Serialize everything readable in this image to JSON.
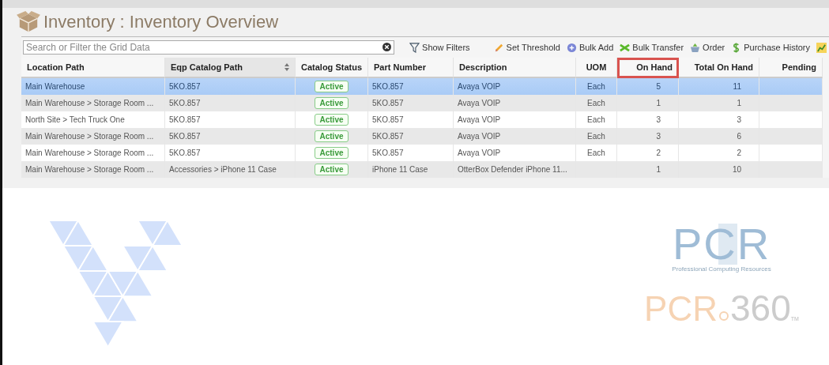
{
  "title": "Inventory : Inventory Overview",
  "search": {
    "placeholder": "Search or Filter the Grid Data"
  },
  "toolbar": [
    {
      "kind": "filter",
      "label": "Show Filters"
    },
    {
      "kind": "pencil",
      "label": "Set Threshold"
    },
    {
      "kind": "plus",
      "label": "Bulk Add"
    },
    {
      "kind": "transfer",
      "label": "Bulk Transfer"
    },
    {
      "kind": "basket",
      "label": "Order"
    },
    {
      "kind": "dollar",
      "label": "Purchase History"
    },
    {
      "kind": "chart"
    }
  ],
  "columns": [
    {
      "label": "Location Path",
      "kind": "text",
      "sorted": false,
      "highlighted": false
    },
    {
      "label": "Eqp Catalog Path",
      "kind": "text",
      "sorted": true,
      "highlighted": false
    },
    {
      "label": "Catalog Status",
      "kind": "badge",
      "sorted": false,
      "highlighted": false
    },
    {
      "label": "Part Number",
      "kind": "text",
      "sorted": false,
      "highlighted": false
    },
    {
      "label": "Description",
      "kind": "text",
      "sorted": false,
      "highlighted": false
    },
    {
      "label": "UOM",
      "kind": "center",
      "sorted": false,
      "highlighted": false
    },
    {
      "label": "On Hand",
      "kind": "number",
      "sorted": false,
      "highlighted": true
    },
    {
      "label": "Total On Hand",
      "kind": "number",
      "sorted": false,
      "highlighted": false
    },
    {
      "label": "Pending",
      "kind": "number",
      "sorted": false,
      "highlighted": false
    }
  ],
  "rows": [
    {
      "selected": true,
      "cells": [
        "Main Warehouse",
        "5KO.857",
        "Active",
        "5KO.857",
        "Avaya VOIP",
        "Each",
        "5",
        "11"
      ]
    },
    {
      "selected": false,
      "cells": [
        "Main Warehouse > Storage Room ...",
        "5KO.857",
        "Active",
        "5KO.857",
        "Avaya VOIP",
        "Each",
        "1",
        "1"
      ]
    },
    {
      "selected": false,
      "cells": [
        "North Site > Tech Truck One",
        "5KO.857",
        "Active",
        "5KO.857",
        "Avaya VOIP",
        "Each",
        "3",
        "3"
      ]
    },
    {
      "selected": false,
      "cells": [
        "Main Warehouse > Storage Room ...",
        "5KO.857",
        "Active",
        "5KO.857",
        "Avaya VOIP",
        "Each",
        "3",
        "6"
      ]
    },
    {
      "selected": false,
      "cells": [
        "Main Warehouse > Storage Room ...",
        "5KO.857",
        "Active",
        "5KO.857",
        "Avaya VOIP",
        "Each",
        "2",
        "2"
      ]
    },
    {
      "selected": false,
      "cells": [
        "Main Warehouse > Storage Room ...",
        "Accessories > iPhone 11 Case",
        "Active",
        "iPhone 11 Case",
        "OtterBox Defender iPhone 11...",
        "",
        "1",
        "10"
      ]
    }
  ],
  "logo": {
    "mark": "PCR",
    "tagline": "Professional Computing Resources",
    "brand": "PCR",
    "number": "360",
    "tm": "TM"
  }
}
